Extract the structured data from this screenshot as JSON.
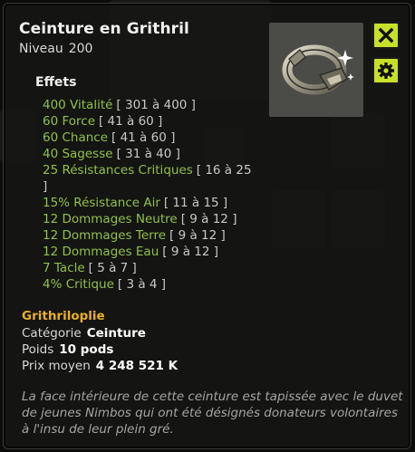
{
  "item": {
    "name": "Ceinture en Grithril",
    "level_label": "Niveau",
    "level": "200"
  },
  "effects_title": "Effets",
  "effects": [
    {
      "text": "400 Vitalité",
      "range": "[ 301 à 400 ]"
    },
    {
      "text": "60 Force",
      "range": "[ 41 à 60 ]"
    },
    {
      "text": "60 Chance",
      "range": "[ 41 à 60 ]"
    },
    {
      "text": "40 Sagesse",
      "range": "[ 31 à 40 ]"
    },
    {
      "text": "25 Résistances Critiques",
      "range": "[ 16 à 25 ]"
    },
    {
      "text": "15% Résistance Air",
      "range": "[ 11 à 15 ]"
    },
    {
      "text": "12 Dommages Neutre",
      "range": "[ 9 à 12 ]"
    },
    {
      "text": "12 Dommages Terre",
      "range": "[ 9 à 12 ]"
    },
    {
      "text": "12 Dommages Eau",
      "range": "[ 9 à 12 ]"
    },
    {
      "text": "7 Tacle",
      "range": "[ 5 à 7 ]"
    },
    {
      "text": "4% Critique",
      "range": "[ 3 à 4 ]"
    }
  ],
  "set_name": "Grithriloplie",
  "properties": [
    {
      "label": "Catégorie",
      "value": "Ceinture"
    },
    {
      "label": "Poids",
      "value": "10 pods"
    },
    {
      "label": "Prix moyen",
      "value": "4 248 521 K"
    }
  ],
  "description": "La face intérieure de cette ceinture est tapissée avec le duvet de jeunes Nimbos qui ont été désignés donateurs volontaires à l'insu de leur plein gré.",
  "colors": {
    "effect_green": "#92c04a",
    "set_gold": "#e8b02a",
    "button_lime": "#c8e02a"
  },
  "icons": {
    "close": "close-icon",
    "settings": "gear-icon",
    "item_preview": "belt-icon"
  }
}
